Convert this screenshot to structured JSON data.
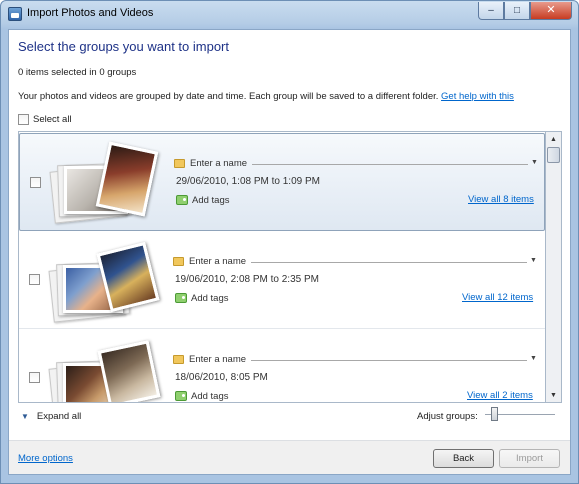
{
  "window": {
    "title": "Import Photos and Videos"
  },
  "controls": {
    "minimize": "–",
    "maximize": "□",
    "close": "✕"
  },
  "heading": "Select the groups you want to import",
  "selection_status": "0 items selected in 0 groups",
  "description": "Your photos and videos are grouped by date and time. Each group will be saved to a different folder.",
  "help_link": "Get help with this",
  "select_all_label": "Select all",
  "groups": [
    {
      "name_placeholder": "Enter a name",
      "date": "29/06/2010, 1:08 PM to 1:09 PM",
      "tags_label": "Add tags",
      "view_link": "View all 8 items",
      "checked": false,
      "highlighted": true
    },
    {
      "name_placeholder": "Enter a name",
      "date": "19/06/2010, 2:08 PM to 2:35 PM",
      "tags_label": "Add tags",
      "view_link": "View all 12 items",
      "checked": false,
      "highlighted": false
    },
    {
      "name_placeholder": "Enter a name",
      "date": "18/06/2010, 8:05 PM",
      "tags_label": "Add tags",
      "view_link": "View all 2 items",
      "checked": false,
      "highlighted": false
    }
  ],
  "expand_all_label": "Expand all",
  "adjust_groups_label": "Adjust groups:",
  "adjust_groups_level": 0.1,
  "footer": {
    "more_options": "More options",
    "back_button": "Back",
    "import_button": "Import"
  },
  "colors": {
    "heading": "#1e3287",
    "link": "#0066cc",
    "titlebar": "#b5cde6"
  },
  "icons": [
    "app-icon",
    "folder-icon",
    "tag-icon",
    "chevron-down-icon",
    "scroll-up-icon",
    "scroll-down-icon"
  ]
}
